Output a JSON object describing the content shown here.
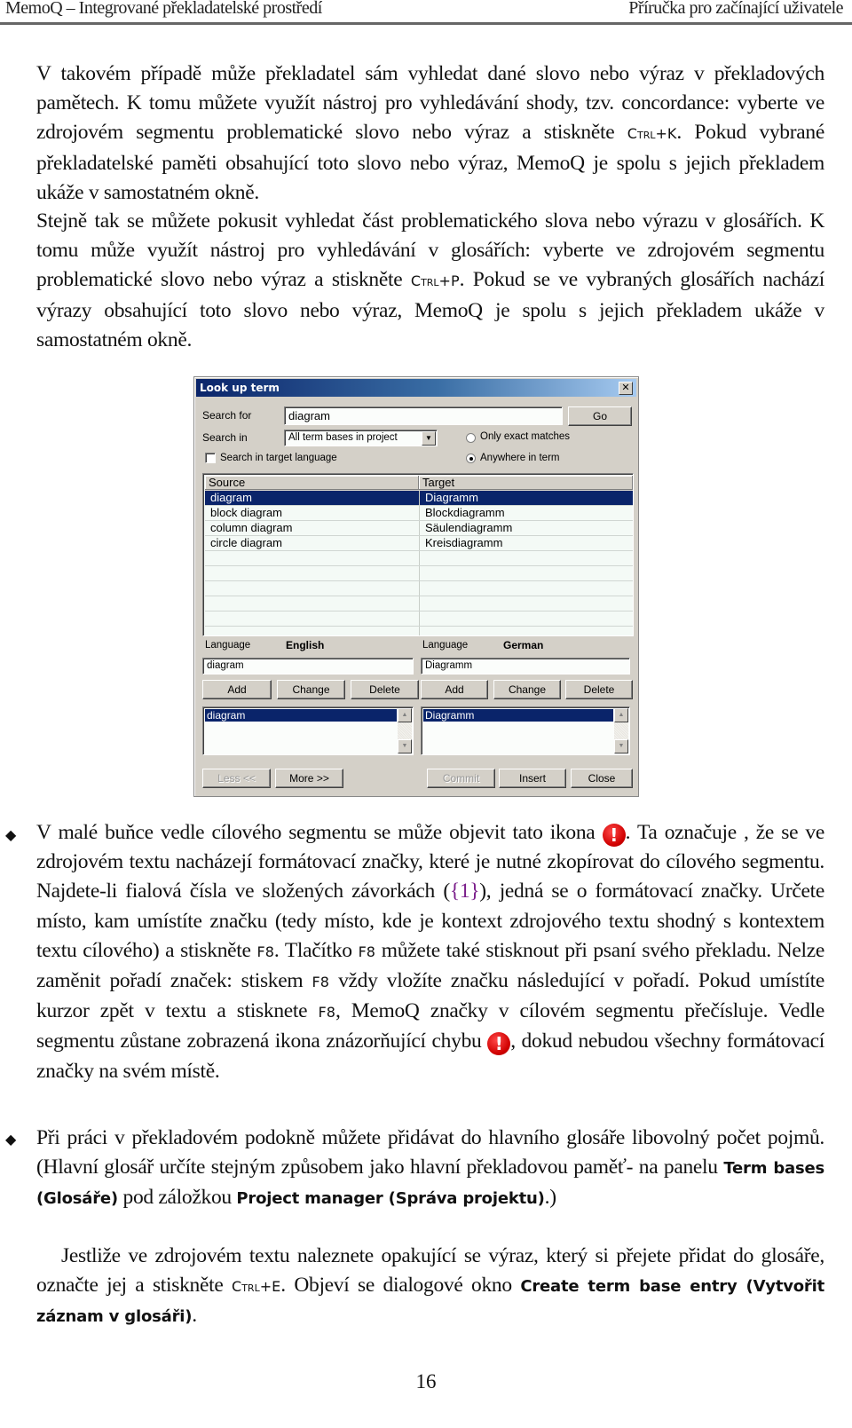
{
  "header": {
    "left": "MemoQ – Integrované překladatelské prostředí",
    "right": "Příručka pro začínající uživatele"
  },
  "intro": {
    "p1_a": "V takovém případě může překladatel sám vyhledat dané slovo nebo výraz v překladových pamětech. K tomu můžete využít nástroj pro vyhledávání shody, tzv. concordance: vyberte ve zdrojovém segmentu problematické slovo nebo výraz a stiskněte ",
    "p1_key": "Ctrl+K",
    "p1_b": ". Pokud vybrané překladatelské paměti obsahující toto slovo nebo výraz, MemoQ je spolu s jejich překladem ukáže v samostatném okně.",
    "p2_a": "Stejně tak se můžete pokusit vyhledat část problematického slova nebo výrazu v glosářích. K tomu může využít nástroj pro vyhledávání v glosářích: vyberte ve zdrojovém segmentu problematické slovo nebo výraz a stiskněte ",
    "p2_key": "Ctrl+P",
    "p2_b": ". Pokud se ve vybraných glosářích nachází výrazy obsahující toto slovo nebo výraz, MemoQ je spolu s jejich překladem ukáže v samostatném okně."
  },
  "dialog": {
    "title": "Look up term",
    "close_glyph": "✕",
    "search_for_label": "Search for",
    "search_for_value": "diagram",
    "go_label": "Go",
    "search_in_label": "Search in",
    "search_in_value": "All term bases in project",
    "search_target_label": "Search in target language",
    "search_target_checked": false,
    "radio_exact_label": "Only exact matches",
    "radio_anywhere_label": "Anywhere in term",
    "selected_match_mode": "Anywhere in term",
    "columns": [
      "Source",
      "Target"
    ],
    "rows": [
      {
        "source": "diagram",
        "target": "Diagramm",
        "selected": true
      },
      {
        "source": "block diagram",
        "target": "Blockdiagramm",
        "selected": false
      },
      {
        "source": "column diagram",
        "target": "Säulendiagramm",
        "selected": false
      },
      {
        "source": "circle diagram",
        "target": "Kreisdiagramm",
        "selected": false
      }
    ],
    "left": {
      "language_label": "Language",
      "language": "English",
      "term_value": "diagram",
      "add": "Add",
      "change": "Change",
      "delete": "Delete",
      "list_items": [
        "diagram"
      ]
    },
    "right": {
      "language_label": "Language",
      "language": "German",
      "term_value": "Diagramm",
      "add": "Add",
      "change": "Change",
      "delete": "Delete",
      "list_items": [
        "Diagramm"
      ]
    },
    "footer": {
      "less": "Less <<",
      "more": "More >>",
      "commit": "Commit",
      "insert": "Insert",
      "close": "Close"
    }
  },
  "bullets": {
    "b1_a": "V malé buňce vedle cílového segmentu se může objevit tato ikona ",
    "b1_b": ". Ta označuje , že se ve zdrojovém textu nacházejí formátovací značky, které je nutné zkopírovat do cílového segmentu. Najdete-li fialová čísla ve složených závorkách (",
    "b1_tag": "{1}",
    "b1_c": "), jedná se o formátovací značky. Určete místo, kam umístíte značku (tedy místo, kde je kontext zdrojového textu shodný s kontextem textu cílového) a stiskněte ",
    "key_f8": "F8",
    "b1_d": ". Tlačítko ",
    "b1_e": " můžete také stisknout při psaní svého překladu. Nelze zaměnit pořadí značek: stiskem ",
    "b1_f": " vždy vložíte značku následující v pořadí. Pokud umístíte kurzor zpět v textu a stisknete ",
    "b1_g": ", MemoQ značky v cílovém segmentu přečísluje. Vedle segmentu zůstane zobrazená ikona znázorňující chybu ",
    "b1_h": ", dokud nebudou všechny formátovací značky na svém místě.",
    "error_icon_glyph": "!",
    "b2_a": "Při práci v překladovém podokně můžete přidávat do hlavního glosáře libovolný počet pojmů. (Hlavní glosář určíte stejným způsobem jako hlavní překladovou paměť- na panelu ",
    "b2_ui1": "Term bases (Glosáře)",
    "b2_b": " pod záložkou ",
    "b2_ui2": "Project manager (Správa projektu)",
    "b2_c": ".)",
    "p3_a": "Jestliže ve zdrojovém textu naleznete opakující se výraz, který si přejete přidat do glosáře, označte jej a stiskněte ",
    "p3_key": "Ctrl+E",
    "p3_b": ". Objeví se dialogové okno ",
    "p3_ui": "Create term base entry (Vytvořit záznam v glosáři)",
    "p3_c": "."
  },
  "page_number": "16"
}
